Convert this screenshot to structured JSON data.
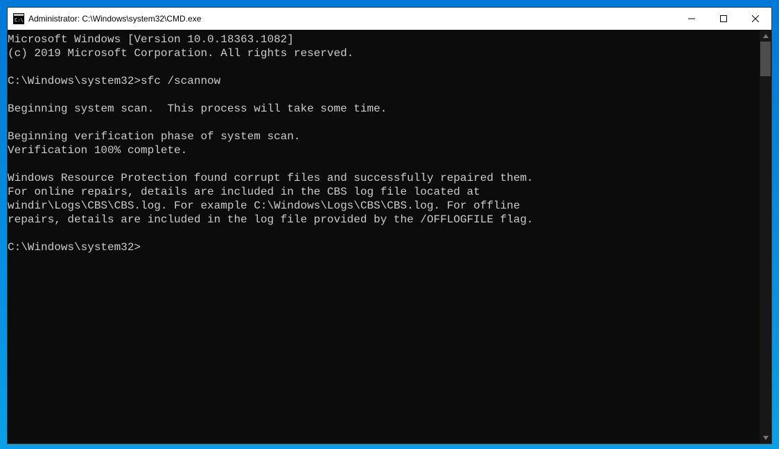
{
  "title": "Administrator: C:\\Windows\\system32\\CMD.exe",
  "console": {
    "lines": [
      "Microsoft Windows [Version 10.0.18363.1082]",
      "(c) 2019 Microsoft Corporation. All rights reserved.",
      "",
      "C:\\Windows\\system32>sfc /scannow",
      "",
      "Beginning system scan.  This process will take some time.",
      "",
      "Beginning verification phase of system scan.",
      "Verification 100% complete.",
      "",
      "Windows Resource Protection found corrupt files and successfully repaired them.",
      "For online repairs, details are included in the CBS log file located at",
      "windir\\Logs\\CBS\\CBS.log. For example C:\\Windows\\Logs\\CBS\\CBS.log. For offline",
      "repairs, details are included in the log file provided by the /OFFLOGFILE flag.",
      "",
      "C:\\Windows\\system32>"
    ]
  },
  "icons": {
    "app": "cmd-icon",
    "minimize": "minimize-icon",
    "maximize": "maximize-icon",
    "close": "close-icon"
  }
}
